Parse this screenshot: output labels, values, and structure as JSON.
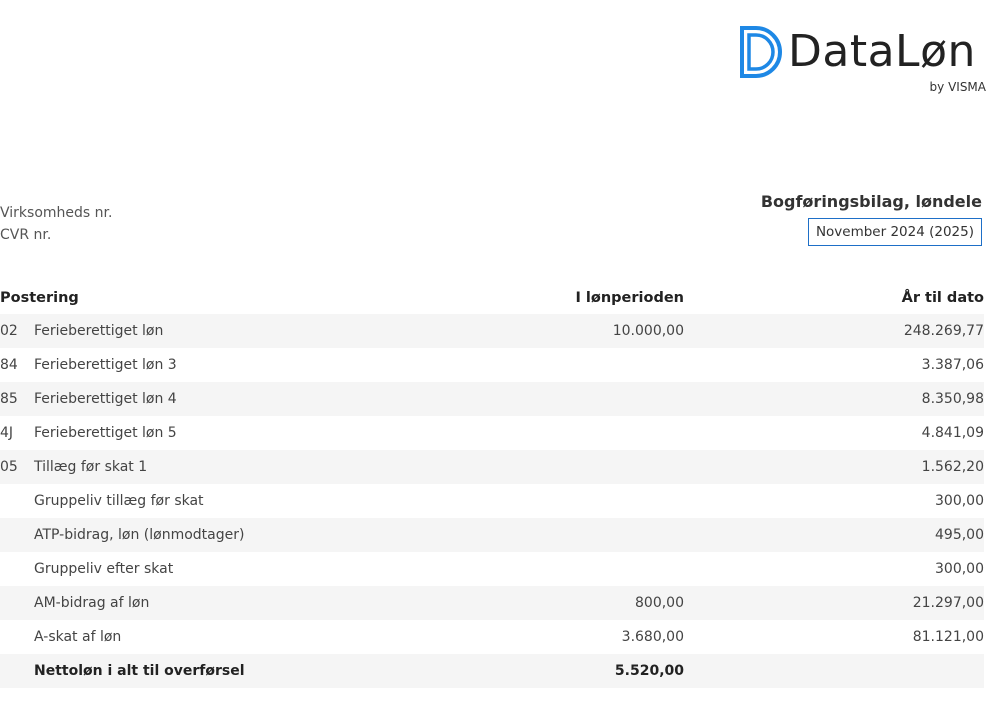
{
  "logo": {
    "wordmark": "DataLøn",
    "byline": "by VISMA",
    "mark_color": "#1e88e5"
  },
  "company": {
    "business_no_label": "Virksomheds nr.",
    "cvr_label": "CVR nr."
  },
  "voucher": {
    "title": "Bogføringsbilag, løndele",
    "period": "November 2024 (2025)",
    "period_border_color": "#1e6fc7"
  },
  "table": {
    "headers": {
      "posting": "Postering",
      "period": "I lønperioden",
      "ytd": "År til dato"
    },
    "rows": [
      {
        "code": "02",
        "desc": "Ferieberettiget løn",
        "period": "10.000,00",
        "ytd": "248.269,77"
      },
      {
        "code": "84",
        "desc": "Ferieberettiget løn 3",
        "period": "",
        "ytd": "3.387,06"
      },
      {
        "code": "85",
        "desc": "Ferieberettiget løn 4",
        "period": "",
        "ytd": "8.350,98"
      },
      {
        "code": "4J",
        "desc": "Ferieberettiget løn 5",
        "period": "",
        "ytd": "4.841,09"
      },
      {
        "code": "05",
        "desc": "Tillæg før skat 1",
        "period": "",
        "ytd": "1.562,20"
      },
      {
        "code": "",
        "desc": "Gruppeliv tillæg før skat",
        "period": "",
        "ytd": "300,00"
      },
      {
        "code": "",
        "desc": "ATP-bidrag, løn (lønmodtager)",
        "period": "",
        "ytd": "495,00"
      },
      {
        "code": "",
        "desc": "Gruppeliv efter skat",
        "period": "",
        "ytd": "300,00"
      },
      {
        "code": "",
        "desc": "AM-bidrag af løn",
        "period": "800,00",
        "ytd": "21.297,00"
      },
      {
        "code": "",
        "desc": "A-skat af løn",
        "period": "3.680,00",
        "ytd": "81.121,00"
      },
      {
        "code": "",
        "desc": "Nettoløn i alt til overførsel",
        "period": "5.520,00",
        "ytd": ""
      }
    ]
  }
}
